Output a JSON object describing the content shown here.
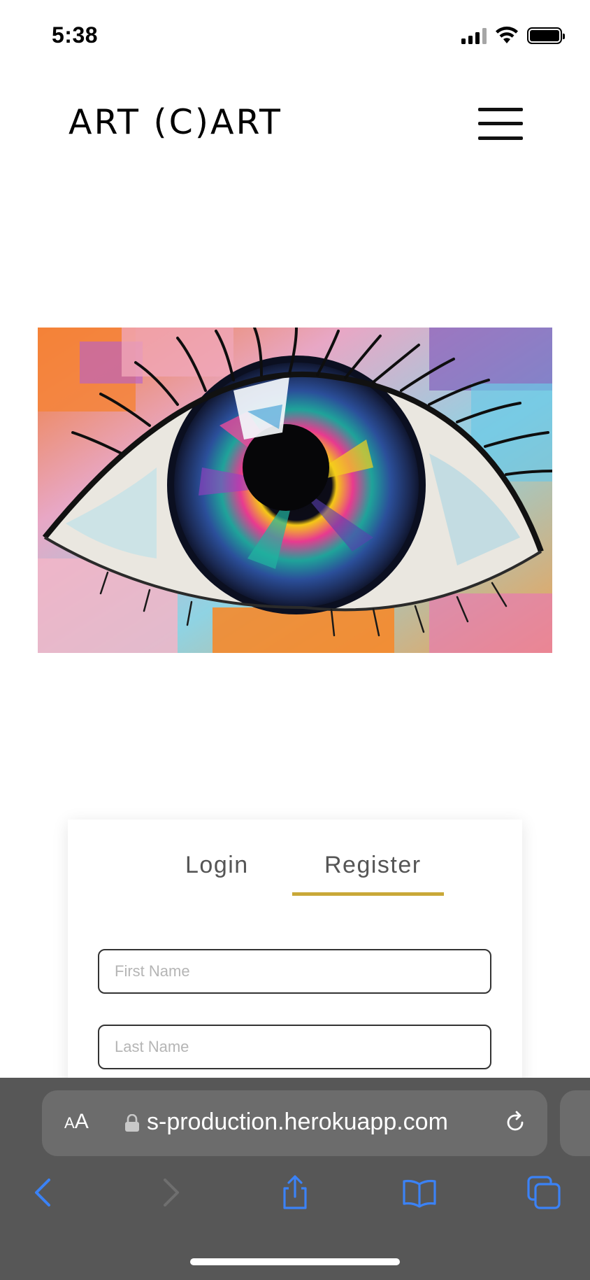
{
  "status_bar": {
    "time": "5:38"
  },
  "header": {
    "brand": "ART (C)ART"
  },
  "auth": {
    "tabs": [
      {
        "label": "Login",
        "active": false
      },
      {
        "label": "Register",
        "active": true
      }
    ],
    "accent_color": "#c9a838",
    "fields": {
      "first_name_placeholder": "First Name",
      "last_name_placeholder": "Last Name"
    }
  },
  "browser": {
    "text_size_label_small": "A",
    "text_size_label_large": "A",
    "url": "s-production.herokuapp.com",
    "bar_color": "#575757",
    "accent_color": "#2f7cf6"
  }
}
